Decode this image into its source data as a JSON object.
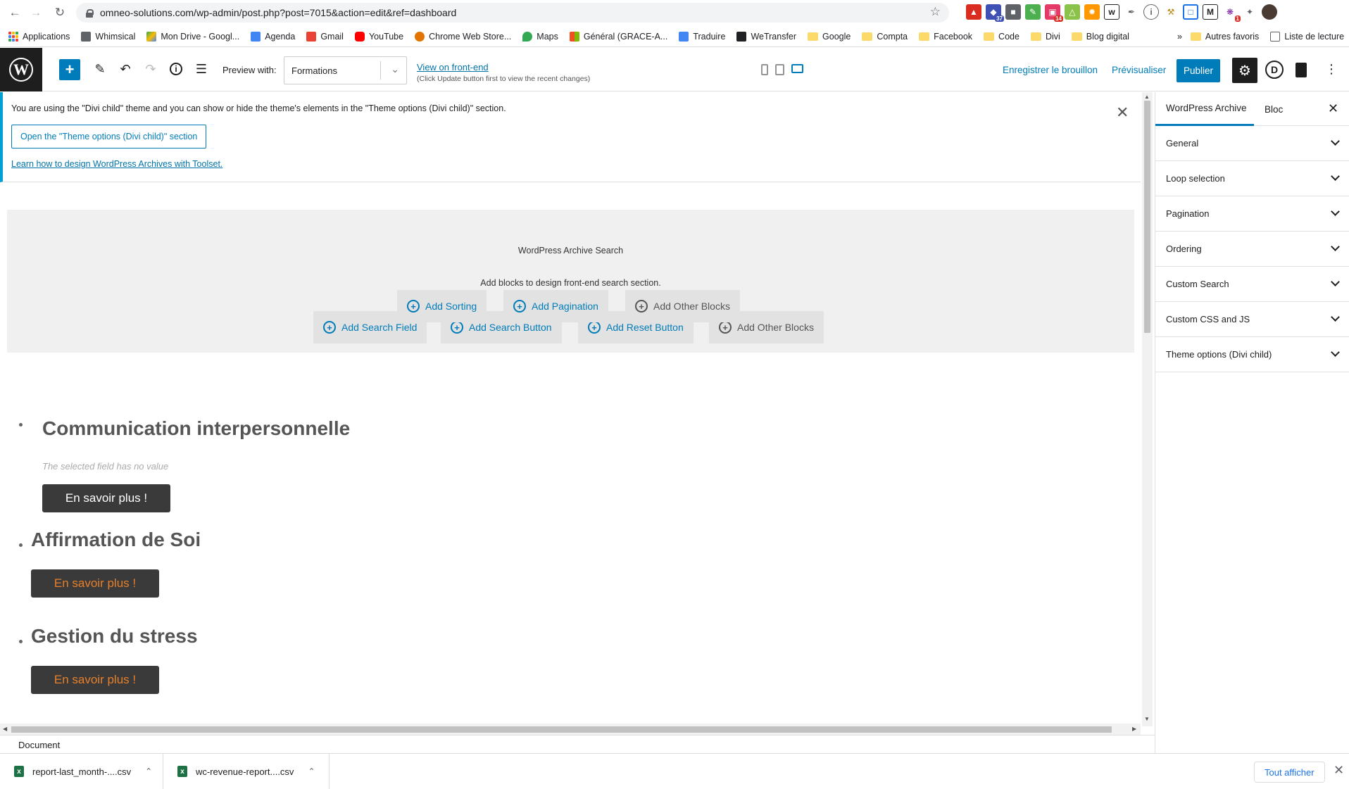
{
  "browser": {
    "url": "omneo-solutions.com/wp-admin/post.php?post=7015&action=edit&ref=dashboard",
    "bookmarks": [
      "Applications",
      "Whimsical",
      "Mon Drive - Googl...",
      "Agenda",
      "Gmail",
      "YouTube",
      "Chrome Web Store...",
      "Maps",
      "Général (GRACE-A...",
      "Traduire",
      "WeTransfer",
      "Google",
      "Compta",
      "Facebook",
      "Code",
      "Divi",
      "Blog digital"
    ],
    "overflow": "»",
    "other_bookmarks": "Autres favoris",
    "reading_list": "Liste de lecture",
    "ext_badges": [
      "37",
      "14",
      "1"
    ]
  },
  "editor_toolbar": {
    "preview_label": "Preview with:",
    "preview_value": "Formations",
    "front_end_link": "View on front-end",
    "front_end_note": "(Click Update button first to view the recent changes)",
    "save_draft": "Enregistrer le brouillon",
    "preview": "Prévisualiser",
    "publish": "Publier",
    "divi_letter": "D"
  },
  "notice": {
    "text": "You are using the \"Divi child\" theme and you can show or hide the theme's elements in the \"Theme options (Divi child)\" section.",
    "button": "Open the \"Theme options (Divi child)\" section",
    "link": "Learn how to design WordPress Archives with Toolset."
  },
  "search_block": {
    "title": "WordPress Archive Search",
    "description": "Add blocks to design front-end search section.",
    "buttons_row1": [
      "Add Search Field",
      "Add Search Button",
      "Add Reset Button",
      "Add Other Blocks"
    ],
    "buttons_row2": [
      "Add Sorting",
      "Add Pagination",
      "Add Other Blocks"
    ]
  },
  "loop_items": [
    {
      "title": "Communication interpersonnelle",
      "empty_field": "The selected field has no value",
      "button": "En savoir plus !"
    },
    {
      "title": "Affirmation de Soi",
      "button": "En savoir plus !"
    },
    {
      "title": "Gestion du stress",
      "button": "En savoir plus !"
    }
  ],
  "footer": {
    "breadcrumb": "Document"
  },
  "sidebar": {
    "tabs": [
      "WordPress Archive",
      "Bloc"
    ],
    "panels": [
      "General",
      "Loop selection",
      "Pagination",
      "Ordering",
      "Custom Search",
      "Custom CSS and JS",
      "Theme options (Divi child)"
    ]
  },
  "downloads": {
    "items": [
      "report-last_month-....csv",
      "wc-revenue-report....csv"
    ],
    "show_all": "Tout afficher"
  },
  "colors": {
    "accent": "#007cba",
    "orange_button_text": "#e8802b",
    "dark_button": "#3a3a3a"
  }
}
